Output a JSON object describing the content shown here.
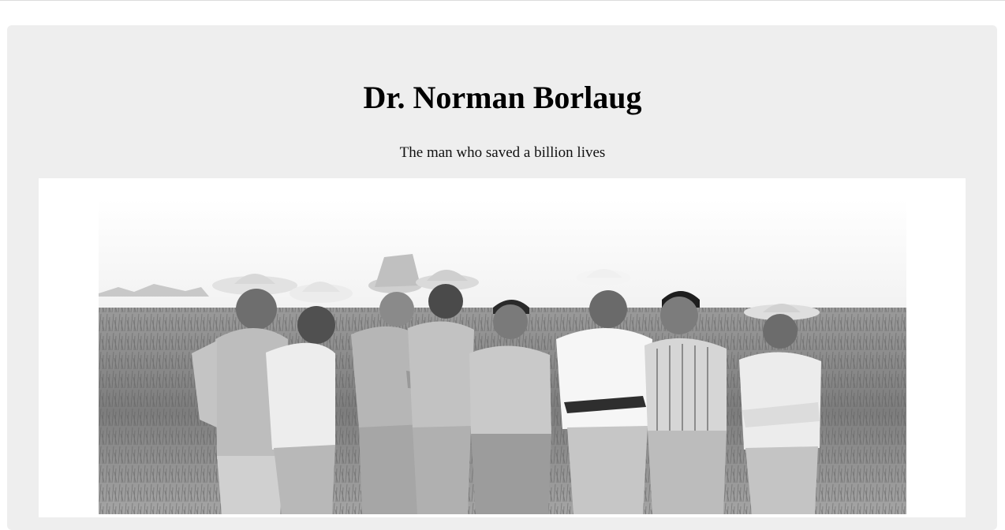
{
  "header": {
    "title": "Dr. Norman Borlaug",
    "tagline": "The man who saved a billion lives"
  },
  "photo": {
    "alt": "Borlaug with colleagues in a wheat field",
    "style": "black-and-white"
  },
  "colors": {
    "jumbotron_bg": "#eeeeee",
    "text": "#000000",
    "thumbnail_bg": "#ffffff"
  }
}
